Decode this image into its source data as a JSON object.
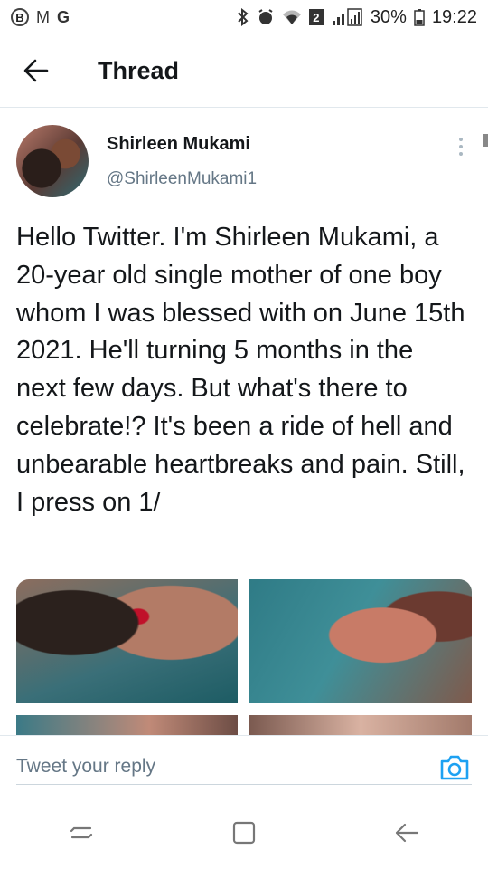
{
  "status_bar": {
    "left_icons": [
      "b-circle-icon",
      "gmail-icon",
      "google-icon"
    ],
    "left_glyphs": [
      "B",
      "M",
      "G"
    ],
    "battery": "30%",
    "time": "19:22",
    "sim_badge": "2"
  },
  "header": {
    "title": "Thread",
    "back_icon": "arrow-left-icon"
  },
  "tweet": {
    "display_name": "Shirleen Mukami",
    "handle": "@ShirleenMukami1",
    "text": "Hello Twitter. I'm Shirleen Mukami, a 20-year old single mother of one boy whom I was blessed with on June 15th 2021. He'll turning 5 months in the next few days. But what's there to celebrate!? It's been a ride of hell and unbearable heartbreaks and pain. Still, I press on 1/",
    "media_count": 4
  },
  "reply": {
    "placeholder": "Tweet your reply",
    "camera_icon": "camera-icon"
  },
  "colors": {
    "accent": "#1da1f2",
    "text": "#14171a",
    "secondary": "#657786",
    "divider": "#e1e8ed"
  },
  "nav_bar": {
    "icons": [
      "recents-icon",
      "home-icon",
      "back-icon"
    ]
  }
}
